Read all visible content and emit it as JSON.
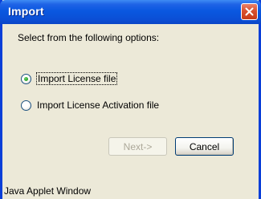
{
  "window": {
    "title": "Import"
  },
  "dialog": {
    "prompt": "Select from the following options:",
    "options": [
      {
        "label": "Import License file",
        "selected": true
      },
      {
        "label": "Import License Activation file",
        "selected": false
      }
    ],
    "buttons": {
      "next_label": "Next->",
      "next_enabled": false,
      "cancel_label": "Cancel"
    }
  },
  "status_bar": {
    "text": "Java Applet Window"
  },
  "colors": {
    "titlebar": "#0a58e0",
    "close_button": "#d9512f",
    "dialog_background": "#ece9d8",
    "radio_dot": "#21a121"
  },
  "icons": {
    "close": "close-icon"
  }
}
